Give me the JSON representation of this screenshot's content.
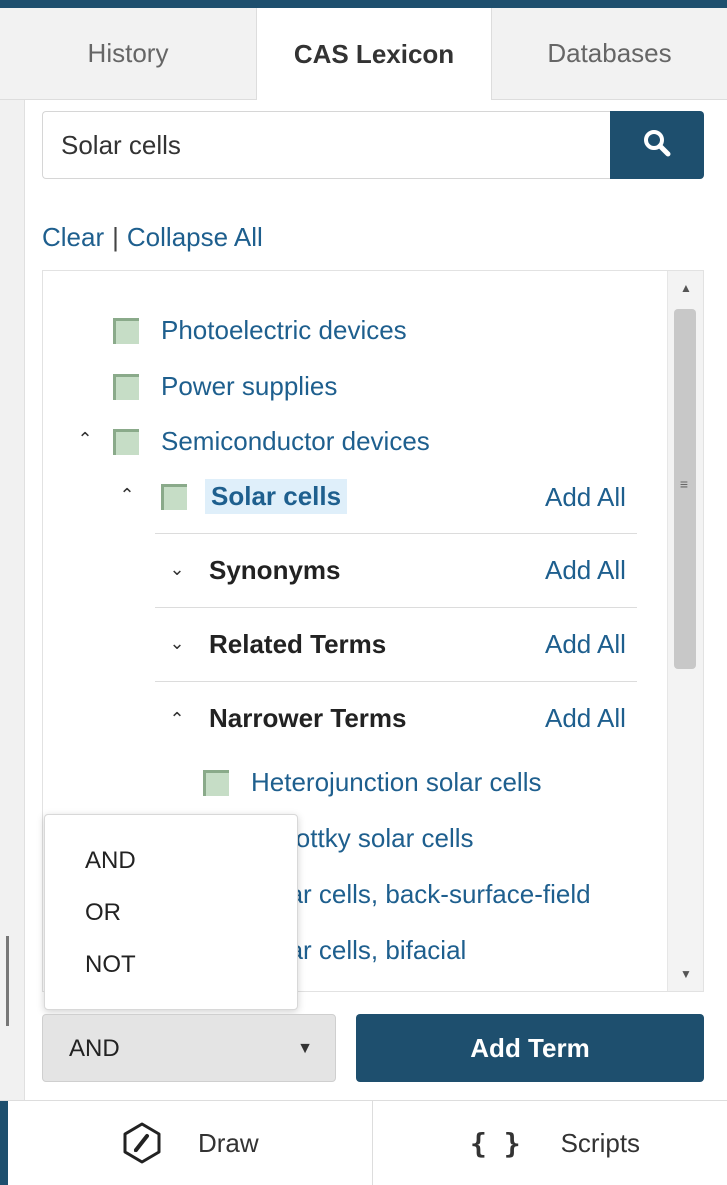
{
  "tabs": [
    {
      "label": "History"
    },
    {
      "label": "CAS Lexicon"
    },
    {
      "label": "Databases"
    }
  ],
  "search": {
    "value": "Solar cells",
    "icon": "search-icon"
  },
  "actions": {
    "clear": "Clear",
    "separator": "|",
    "collapse_all": "Collapse All"
  },
  "tree": {
    "items": [
      {
        "label": "Photoelectric devices"
      },
      {
        "label": "Power supplies"
      },
      {
        "label": "Semiconductor devices"
      },
      {
        "label": "Solar cells"
      }
    ],
    "add_all": "Add All",
    "sections": [
      {
        "label": "Synonyms"
      },
      {
        "label": "Related Terms"
      },
      {
        "label": "Narrower Terms"
      }
    ],
    "narrower": [
      {
        "label": "Heterojunction solar cells"
      },
      {
        "label": "Schottky solar cells"
      },
      {
        "label": "Solar cells, back-surface-field"
      },
      {
        "label": "Solar cells, bifacial"
      }
    ]
  },
  "operator_menu": {
    "options": [
      "AND",
      "OR",
      "NOT"
    ],
    "selected": "AND"
  },
  "add_term_label": "Add Term",
  "bottom_tabs": {
    "draw": "Draw",
    "scripts": "Scripts"
  },
  "colors": {
    "primary": "#1e4f6e",
    "link": "#1e5f8e",
    "checkbox": "#c6ddc6"
  }
}
